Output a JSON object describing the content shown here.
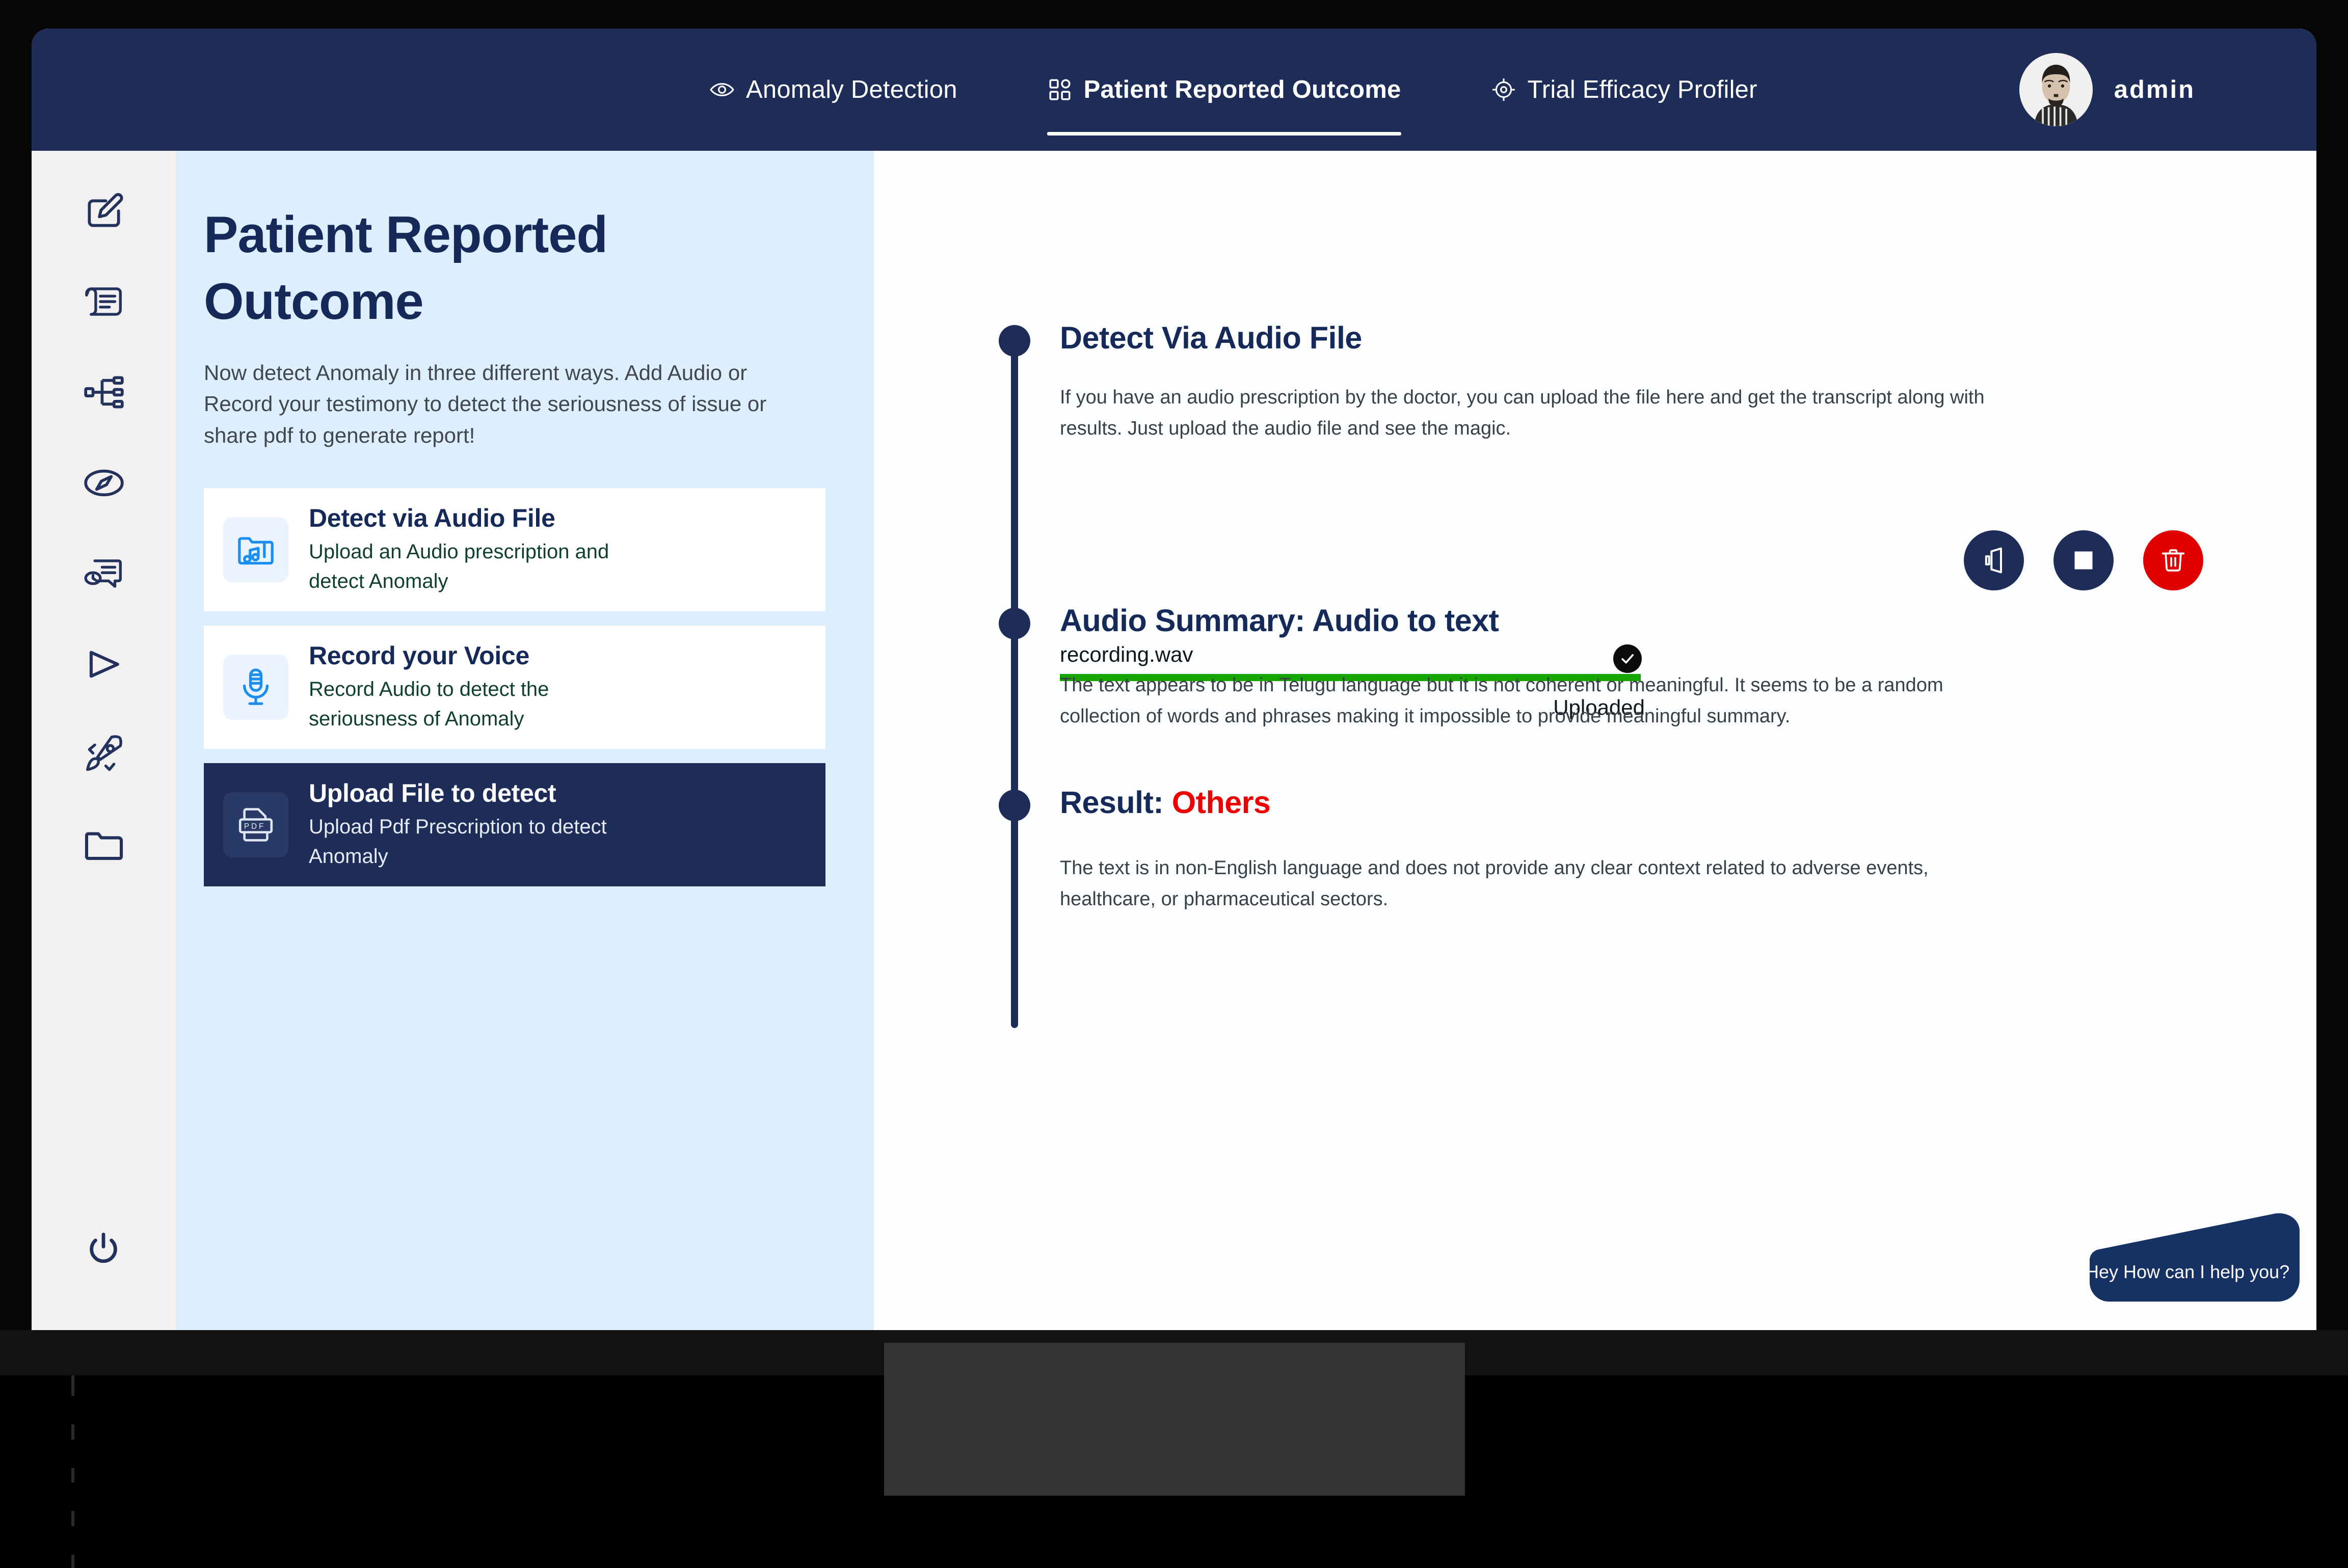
{
  "topnav": {
    "items": [
      {
        "label": "Anomaly Detection",
        "icon": "eye-icon",
        "active": false
      },
      {
        "label": "Patient Reported Outcome",
        "icon": "grid-icon",
        "active": true
      },
      {
        "label": "Trial Efficacy Profiler",
        "icon": "target-icon",
        "active": false
      }
    ],
    "username": "admin",
    "avatar_icon": "user-avatar-photo"
  },
  "rail": {
    "items": [
      {
        "icon": "edit-square-icon"
      },
      {
        "icon": "scroll-document-icon"
      },
      {
        "icon": "sitemap-hierarchy-icon"
      },
      {
        "icon": "compass-icon"
      },
      {
        "icon": "message-history-icon"
      },
      {
        "icon": "cursor-play-icon"
      },
      {
        "icon": "rocket-icon"
      },
      {
        "icon": "folder-icon"
      }
    ],
    "power": {
      "icon": "power-icon"
    }
  },
  "left_panel": {
    "title": "Patient Reported Outcome",
    "subtitle": "Now detect Anomaly in three different ways. Add Audio or Record your testimony to detect the seriousness of issue or share pdf to generate report!",
    "cards": [
      {
        "title": "Detect via Audio File",
        "desc": "Upload an Audio prescription and detect Anomaly",
        "icon": "audio-folder-icon",
        "selected": false
      },
      {
        "title": "Record your Voice",
        "desc": "Record Audio to detect the seriousness of Anomaly",
        "icon": "microphone-icon",
        "selected": false
      },
      {
        "title": "Upload File to detect",
        "desc": "Upload Pdf Prescription to detect Anomaly",
        "icon": "pdf-file-icon",
        "selected": true
      }
    ]
  },
  "main": {
    "sections": [
      {
        "heading": "Detect Via Audio File",
        "body": "If you have an audio prescription by the doctor, you can upload the file here and get the transcript along with results. Just upload the audio file and see the magic."
      },
      {
        "heading": "Audio Summary: Audio to text",
        "body": "The text appears to be in Telugu language but it is not coherent or meaningful. It seems to be a random collection  of words and phrases making it impossible to provide  meaningful summary."
      },
      {
        "heading_prefix": "Result: ",
        "heading_accent": "Others",
        "body": "The text is in  non-English language and does not provide any clear context related to adverse events, healthcare, or pharmaceutical sectors."
      }
    ],
    "upload": {
      "filename": "recording.wav",
      "status": "Uploaded",
      "progress_percent": 100,
      "check_icon": "check-circle-icon"
    },
    "actions": [
      {
        "name": "play-audio",
        "icon": "speaker-icon",
        "style": "primary"
      },
      {
        "name": "stop-audio",
        "icon": "stop-square-icon",
        "style": "primary"
      },
      {
        "name": "delete-audio",
        "icon": "trash-icon",
        "style": "danger"
      }
    ]
  },
  "chat": {
    "message": "Hey How can I help you?"
  },
  "colors": {
    "navy": "#1e2d58",
    "deep_navy": "#152a58",
    "panel_blue": "#ddeefc",
    "rail_grey": "#f3f0f1",
    "accent_red": "#ee0000",
    "danger_red": "#e00000",
    "progress_green": "#15a600",
    "icon_blue": "#1b8ef0"
  }
}
